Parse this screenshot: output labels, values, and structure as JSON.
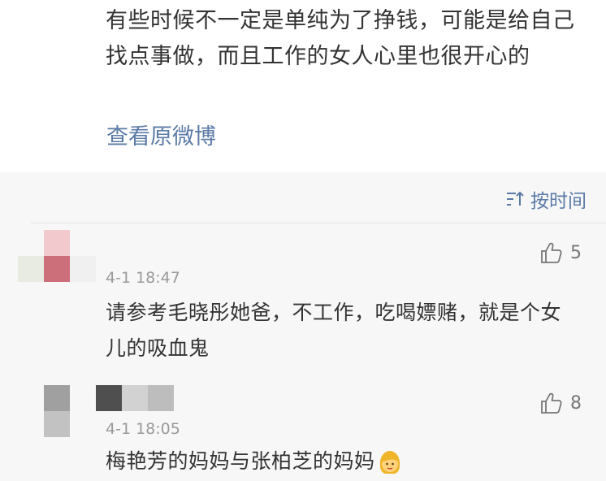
{
  "post": {
    "text": "有些时候不一定是单纯为了挣钱，可能是给自己找点事做，而且工作的女人心里也很开心的",
    "view_original": "查看原微博"
  },
  "sort": {
    "label": "按时间"
  },
  "comments": [
    {
      "time": "4-1 18:47",
      "text": "请参考毛晓彤她爸，不工作，吃喝嫖赌，就是个女儿的吸血鬼",
      "likes": "5"
    },
    {
      "time": "4-1 18:05",
      "text": "梅艳芳的妈妈与张柏芝的妈妈",
      "likes": "8",
      "emoji": "woman-face-emoji"
    }
  ],
  "colors": {
    "link": "#5b7aa6",
    "text": "#333333",
    "meta": "#9a9a9a",
    "bg": "#f7f7f7"
  }
}
